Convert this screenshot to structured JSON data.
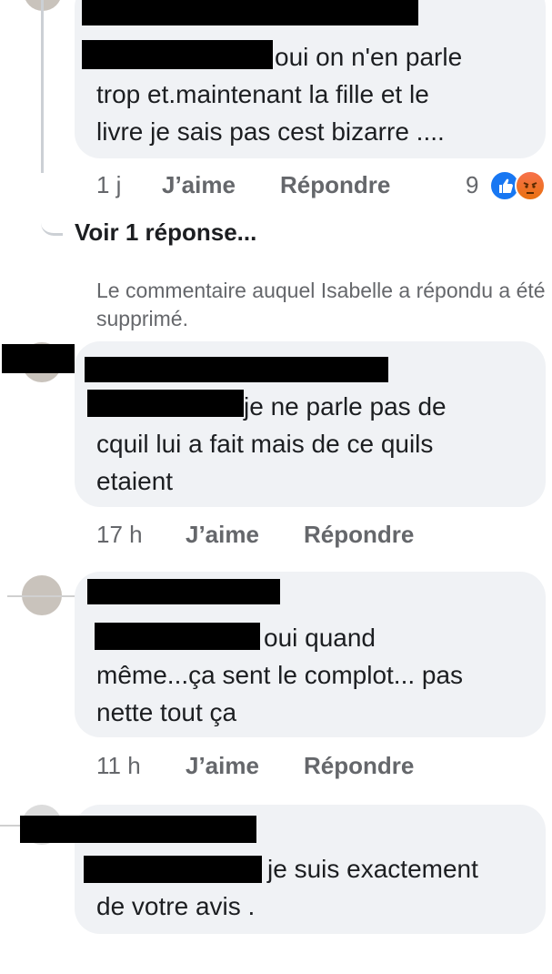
{
  "comments": [
    {
      "text": "oui on n'en parle\ntrop et.maintenant la fille et le\nlivre je sais pas cest bizarre ....",
      "time": "1 j",
      "like_label": "J’aime",
      "reply_label": "Répondre",
      "reaction_count": "9",
      "reactions": [
        "like-icon",
        "angry-icon"
      ]
    },
    {
      "text": "je ne parle pas de\ncquil lui a fait mais de ce quils\netaient",
      "time": "17 h",
      "like_label": "J’aime",
      "reply_label": "Répondre"
    },
    {
      "text": "oui quand\nmême...ça sent le complot... pas\nnette tout ça",
      "time": "11 h",
      "like_label": "J’aime",
      "reply_label": "Répondre"
    },
    {
      "text": "je suis exactement\nde votre avis .",
      "time": "",
      "like_label": "",
      "reply_label": ""
    }
  ],
  "see_replies": "Voir 1 réponse...",
  "deleted_notice": "Le commentaire auquel Isabelle a répondu a été supprimé.",
  "colors": {
    "bubble": "#f0f2f5",
    "meta_text": "#65676b",
    "like_blue": "#1877f2",
    "angry_orange": "#f7714c"
  }
}
